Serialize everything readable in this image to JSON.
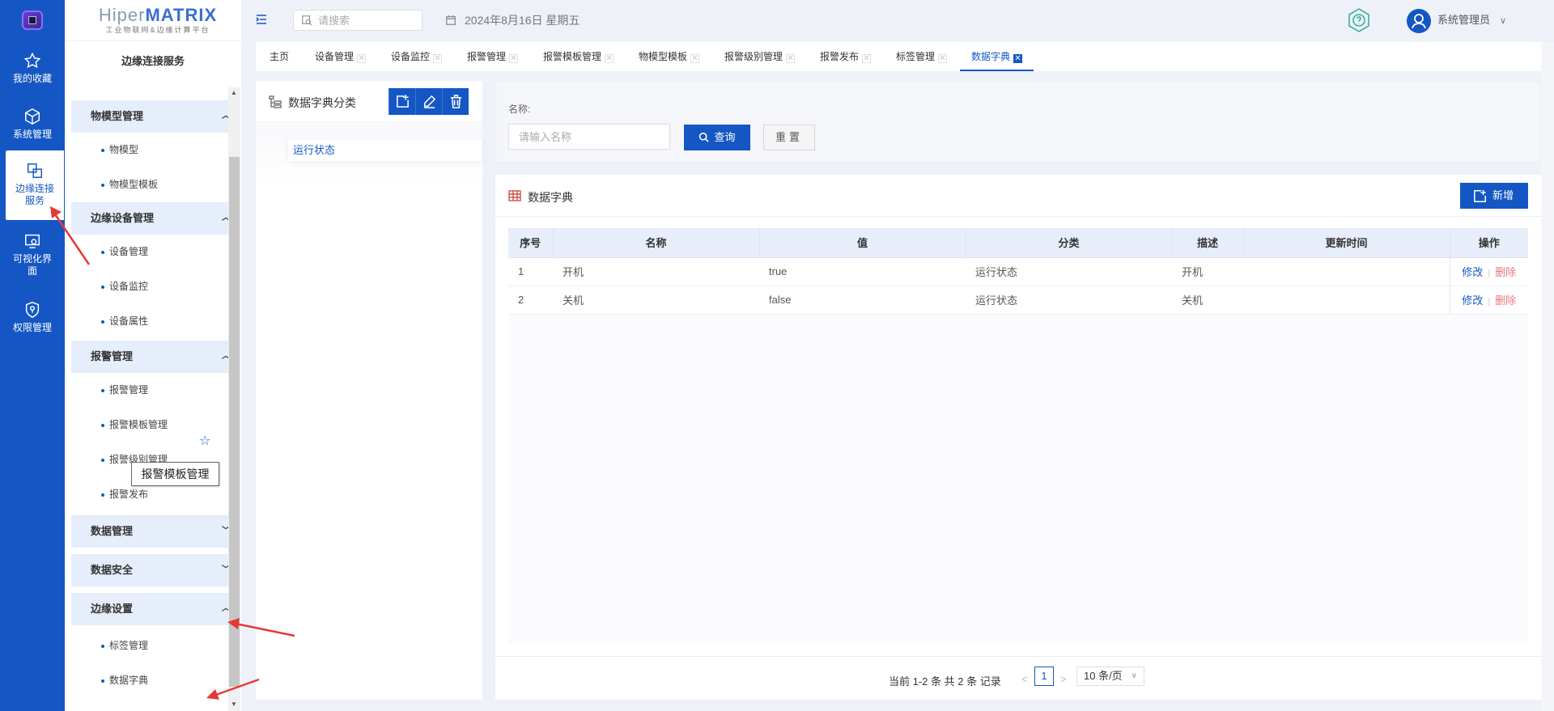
{
  "brand": {
    "name_a": "Hiper",
    "name_b": "MATRIX",
    "subtitle": "工业物联网&边缘计算平台"
  },
  "rail": [
    {
      "label": "我的收藏",
      "icon": "star-icon"
    },
    {
      "label": "系统管理",
      "icon": "cube-icon"
    },
    {
      "label": "边缘连接服务",
      "icon": "link-icon"
    },
    {
      "label": "可视化界面",
      "icon": "monitor-icon"
    },
    {
      "label": "权限管理",
      "icon": "shield-icon"
    }
  ],
  "submenu": {
    "title": "边缘连接服务",
    "groups": [
      {
        "label": "物模型管理",
        "expanded": true,
        "items": [
          "物模型",
          "物模型模板"
        ]
      },
      {
        "label": "边缘设备管理",
        "expanded": true,
        "items": [
          "设备管理",
          "设备监控",
          "设备属性"
        ]
      },
      {
        "label": "报警管理",
        "expanded": true,
        "items": [
          "报警管理",
          "报警模板管理",
          "报警级别管理",
          "报警发布"
        ]
      },
      {
        "label": "数据管理",
        "expanded": false,
        "items": []
      },
      {
        "label": "数据安全",
        "expanded": false,
        "items": []
      },
      {
        "label": "边缘设置",
        "expanded": true,
        "items": [
          "标签管理",
          "数据字典"
        ]
      }
    ],
    "tooltip": "报警模板管理"
  },
  "topbar": {
    "search_placeholder": "请搜索",
    "date": "2024年8月16日 星期五",
    "user": "系统管理员"
  },
  "tabs": [
    "主页",
    "设备管理",
    "设备监控",
    "报警管理",
    "报警模板管理",
    "物模型模板",
    "报警级别管理",
    "报警发布",
    "标签管理",
    "数据字典"
  ],
  "active_tab": "数据字典",
  "category": {
    "title": "数据字典分类",
    "items": [
      "运行状态"
    ]
  },
  "filter": {
    "name_label": "名称:",
    "name_placeholder": "请输入名称",
    "query_label": "查询",
    "reset_label": "重置"
  },
  "table": {
    "title": "数据字典",
    "add_label": "新增",
    "columns": [
      "序号",
      "名称",
      "值",
      "分类",
      "描述",
      "更新时间",
      "操作"
    ],
    "rows": [
      {
        "index": "1",
        "name": "开机",
        "value": "true",
        "category": "运行状态",
        "desc": "开机",
        "updated": ""
      },
      {
        "index": "2",
        "name": "关机",
        "value": "false",
        "category": "运行状态",
        "desc": "关机",
        "updated": ""
      }
    ],
    "edit_label": "修改",
    "delete_label": "删除"
  },
  "pager": {
    "info": "当前 1-2 条 共 2 条 记录",
    "current_page": "1",
    "page_size": "10 条/页"
  },
  "colors": {
    "primary": "#1457c4",
    "danger": "#e8767a",
    "annotation": "#e53935"
  }
}
